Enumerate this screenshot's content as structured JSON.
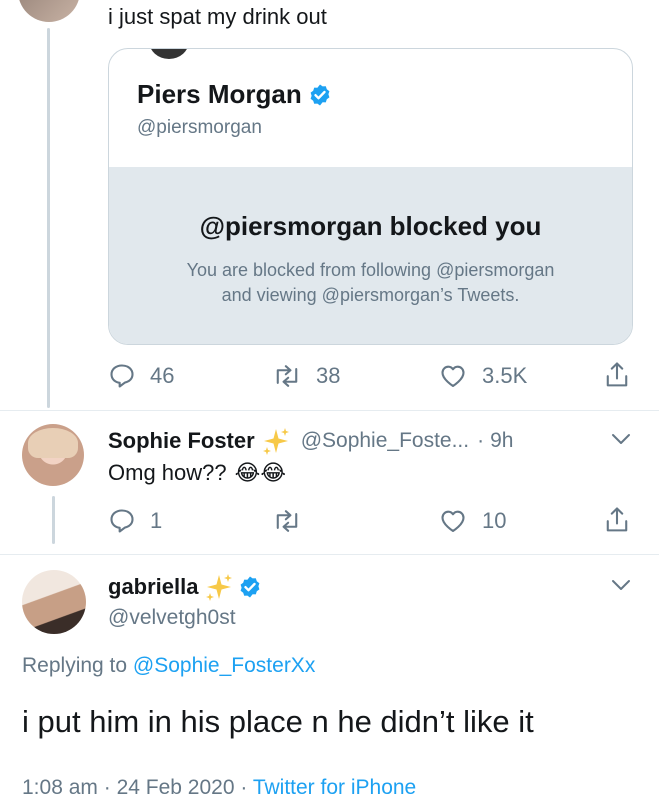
{
  "first_tweet": {
    "text": "i just spat my drink out",
    "quoted": {
      "name": "Piers Morgan",
      "handle": "@piersmorgan",
      "blocked_title": "@piersmorgan blocked you",
      "blocked_line1": "You are blocked from following @piersmorgan",
      "blocked_line2": "and viewing @piersmorgan’s Tweets."
    },
    "actions": {
      "replies": "46",
      "retweets": "38",
      "likes": "3.5K"
    }
  },
  "reply": {
    "name": "Sophie Foster",
    "handle": "@Sophie_Foste...",
    "separator": "·",
    "time": "9h",
    "text": "Omg how??",
    "emoji": "😂😂",
    "actions": {
      "replies": "1",
      "retweets": "",
      "likes": "10"
    }
  },
  "main_tweet": {
    "name": "gabriella",
    "handle": "@velvetgh0st",
    "replying_prefix": "Replying to ",
    "replying_to": "@Sophie_FosterXx",
    "text": "i put him in his place n he didn’t like it",
    "time": "1:08 am",
    "sep1": "·",
    "date": "24 Feb 2020",
    "sep2": "·",
    "source": "Twitter for iPhone"
  },
  "colors": {
    "link": "#1da1f2",
    "verified": "#1da1f2",
    "muted": "#657786",
    "card_bg": "#e1e8ed",
    "thread_line": "#ccd6dd"
  },
  "icons": [
    "reply-icon",
    "retweet-icon",
    "like-icon",
    "share-icon",
    "chevron-down-icon",
    "verified-icon",
    "sparkles-icon"
  ]
}
